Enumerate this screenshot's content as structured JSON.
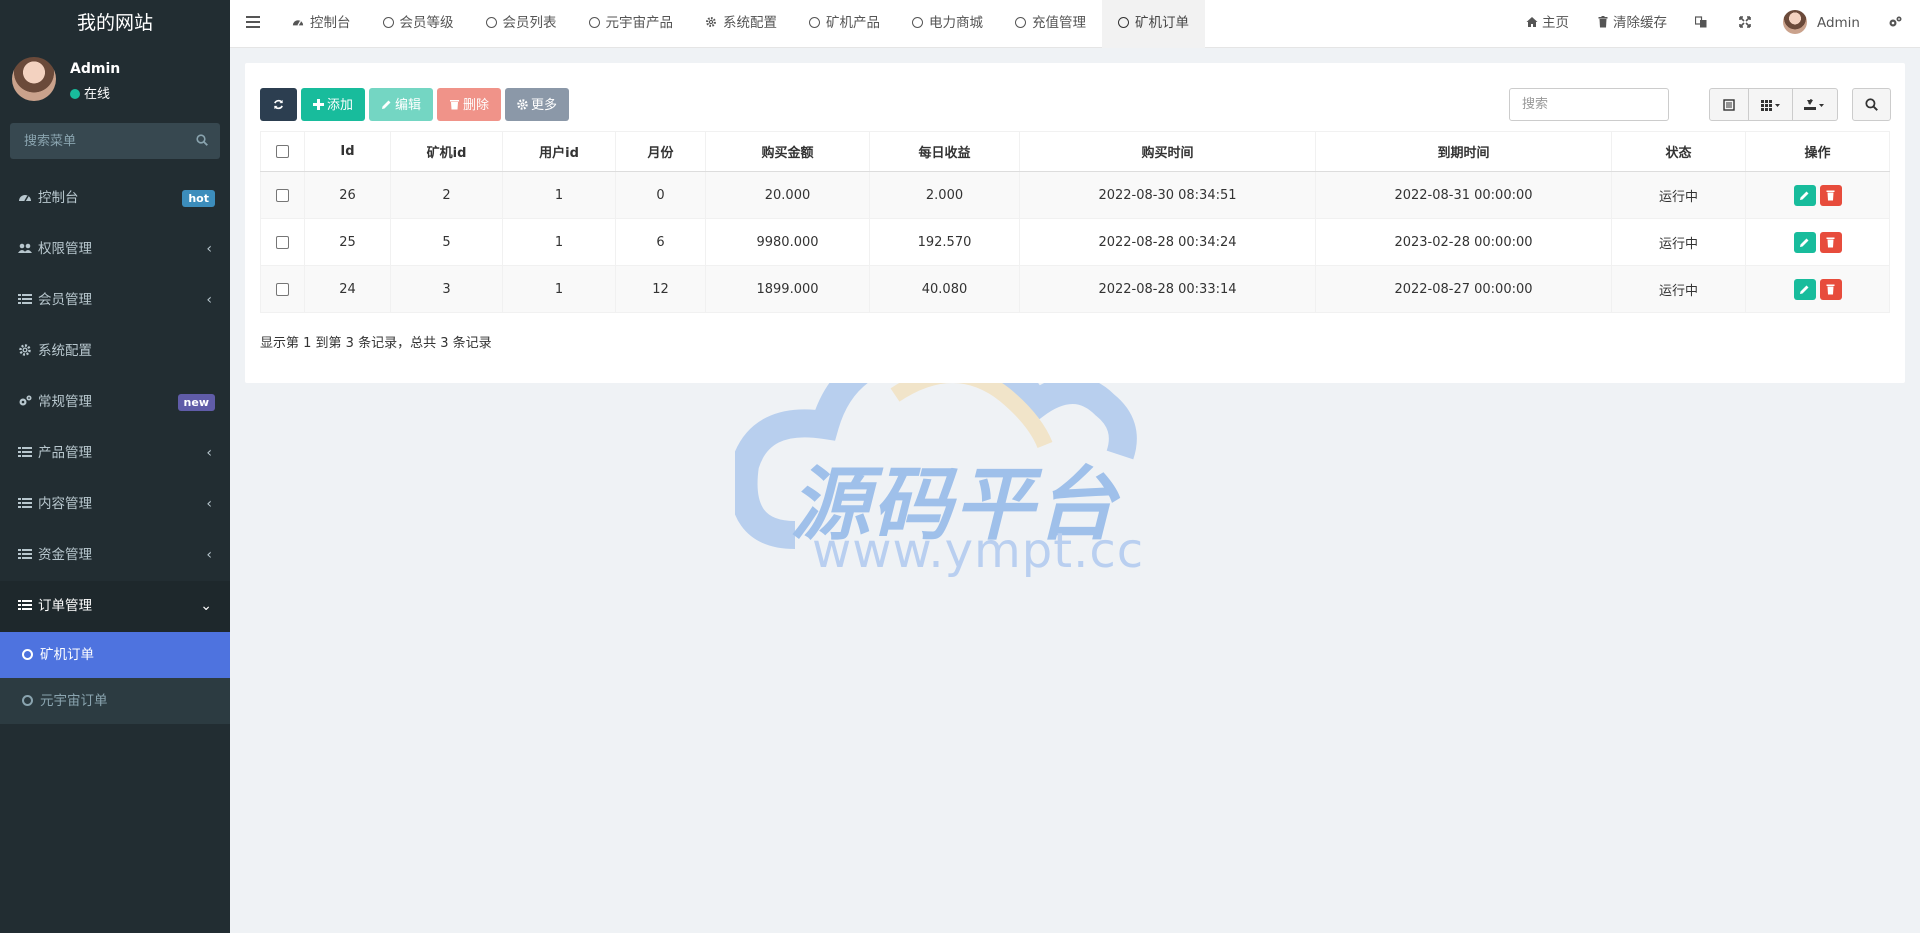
{
  "brand": "我的网站",
  "user": {
    "name": "Admin",
    "status": "在线"
  },
  "sidebar_search": {
    "placeholder": "搜索菜单"
  },
  "menu": [
    {
      "label": "控制台",
      "icon": "dashboard-icon",
      "badge": "hot",
      "badge_color": "#3c8dbc"
    },
    {
      "label": "权限管理",
      "icon": "users-icon",
      "chevron": "‹"
    },
    {
      "label": "会员管理",
      "icon": "list-icon",
      "chevron": "‹"
    },
    {
      "label": "系统配置",
      "icon": "gear-icon"
    },
    {
      "label": "常规管理",
      "icon": "gears-icon",
      "badge": "new",
      "badge_color": "#605ca8"
    },
    {
      "label": "产品管理",
      "icon": "list-icon",
      "chevron": "‹"
    },
    {
      "label": "内容管理",
      "icon": "list-icon",
      "chevron": "‹"
    },
    {
      "label": "资金管理",
      "icon": "list-icon",
      "chevron": "‹"
    },
    {
      "label": "订单管理",
      "icon": "list-icon",
      "chevron": "⌄"
    }
  ],
  "submenu": [
    {
      "label": "矿机订单",
      "active": true
    },
    {
      "label": "元宇宙订单",
      "active": false
    }
  ],
  "tabs": [
    {
      "label": "控制台",
      "icon": "dashboard-icon"
    },
    {
      "label": "会员等级",
      "icon": "ring"
    },
    {
      "label": "会员列表",
      "icon": "ring"
    },
    {
      "label": "元宇宙产品",
      "icon": "ring"
    },
    {
      "label": "系统配置",
      "icon": "gear-icon"
    },
    {
      "label": "矿机产品",
      "icon": "ring"
    },
    {
      "label": "电力商城",
      "icon": "ring"
    },
    {
      "label": "充值管理",
      "icon": "ring"
    },
    {
      "label": "矿机订单",
      "icon": "ring",
      "active": true
    }
  ],
  "header_right": {
    "home": "主页",
    "clear_cache": "清除缓存",
    "user": "Admin"
  },
  "toolbar": {
    "add": "添加",
    "edit": "编辑",
    "delete": "删除",
    "more": "更多"
  },
  "table_search": {
    "placeholder": "搜索"
  },
  "table": {
    "columns": [
      "Id",
      "矿机id",
      "用户id",
      "月份",
      "购买金额",
      "每日收益",
      "购买时间",
      "到期时间",
      "状态",
      "操作"
    ],
    "rows": [
      [
        "26",
        "2",
        "1",
        "0",
        "20.000",
        "2.000",
        "2022-08-30 08:34:51",
        "2022-08-31 00:00:00",
        "运行中"
      ],
      [
        "25",
        "5",
        "1",
        "6",
        "9980.000",
        "192.570",
        "2022-08-28 00:34:24",
        "2023-02-28 00:00:00",
        "运行中"
      ],
      [
        "24",
        "3",
        "1",
        "12",
        "1899.000",
        "40.080",
        "2022-08-28 00:33:14",
        "2022-08-27 00:00:00",
        "运行中"
      ]
    ]
  },
  "summary": "显示第 1 到第 3 条记录，总共 3 条记录",
  "watermark": {
    "title": "源码平台",
    "url": "www.ympt.cc"
  },
  "colors": {
    "sidebar_bg": "#222d32",
    "active_sub": "#4e73df",
    "success": "#18bc9c",
    "danger": "#e74c3c"
  }
}
